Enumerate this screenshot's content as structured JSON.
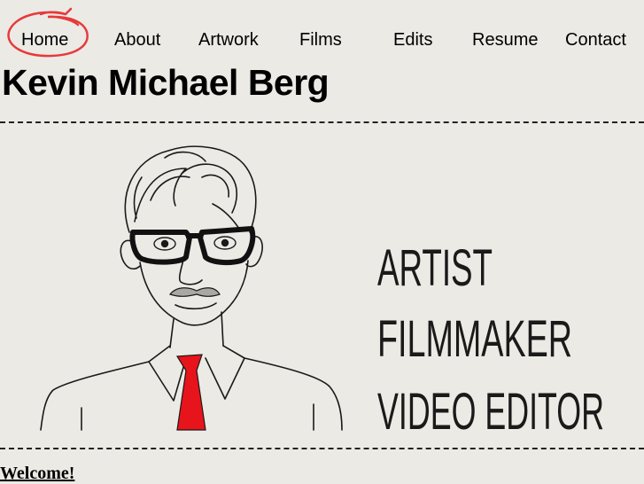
{
  "nav": {
    "items": [
      {
        "label": "Home",
        "active": true
      },
      {
        "label": "About"
      },
      {
        "label": "Artwork"
      },
      {
        "label": "Films"
      },
      {
        "label": "Edits"
      },
      {
        "label": "Resume"
      },
      {
        "label": "Contact"
      }
    ],
    "active_circle_color": "#e8393c"
  },
  "header": {
    "title": "Kevin Michael Berg"
  },
  "hero": {
    "lines": [
      "ARTIST",
      "FILMMAKER",
      "VIDEO EDITOR"
    ],
    "tie_color": "#e8141b"
  },
  "main": {
    "welcome": "Welcome!"
  }
}
